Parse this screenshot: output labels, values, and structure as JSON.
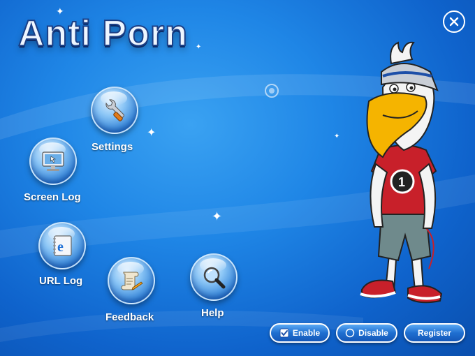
{
  "app": {
    "title": "Anti Porn"
  },
  "nav": {
    "settings": "Settings",
    "screen_log": "Screen Log",
    "url_log": "URL Log",
    "feedback": "Feedback",
    "help": "Help"
  },
  "footer": {
    "enable": "Enable",
    "disable": "Disable",
    "register": "Register"
  },
  "colors": {
    "background": "#1f86e6",
    "button": "#1f6fd0",
    "mascot_shirt": "#c8202a",
    "mascot_pants": "#6f8a8c",
    "beak": "#f5b400"
  },
  "icons": {
    "settings": "wrench-icon",
    "screen_log": "monitor-icon",
    "url_log": "internet-explorer-book-icon",
    "feedback": "scroll-pen-icon",
    "help": "magnifier-icon",
    "close": "close-circle-icon"
  }
}
